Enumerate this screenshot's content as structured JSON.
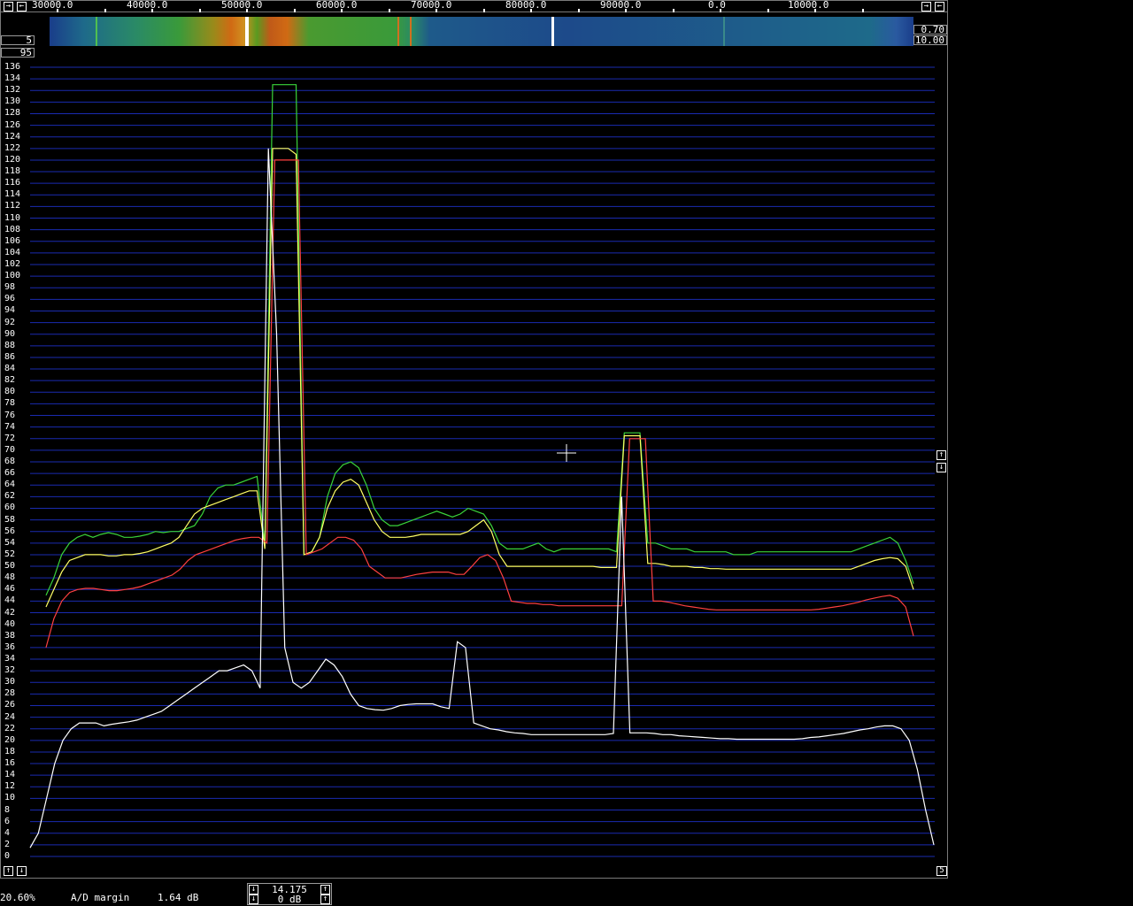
{
  "window": {
    "freq_axis_labels": [
      "30000.0",
      "40000.0",
      "50000.0",
      "60000.0",
      "70000.0",
      "80000.0",
      "90000.0",
      "0.0",
      "10000.0"
    ],
    "left_value_top": "5",
    "left_value_bottom": "95",
    "right_value_top": "0.70",
    "right_value_bottom": "10.00",
    "y_axis_labels": [
      "136",
      "134",
      "132",
      "130",
      "128",
      "126",
      "124",
      "122",
      "120",
      "118",
      "116",
      "114",
      "112",
      "110",
      "108",
      "106",
      "104",
      "102",
      "100",
      "98",
      "96",
      "94",
      "92",
      "90",
      "88",
      "86",
      "84",
      "82",
      "80",
      "78",
      "76",
      "74",
      "72",
      "70",
      "68",
      "66",
      "64",
      "62",
      "60",
      "58",
      "56",
      "54",
      "52",
      "50",
      "48",
      "46",
      "44",
      "42",
      "40",
      "38",
      "36",
      "34",
      "32",
      "30",
      "28",
      "26",
      "24",
      "22",
      "20",
      "18",
      "16",
      "14",
      "12",
      "10",
      "8",
      "6",
      "4",
      "2",
      "0"
    ],
    "bottom_right_value": "5"
  },
  "status": {
    "percent": "20.60%",
    "ad_margin_label": "A/D margin",
    "ad_margin_value": "1.64 dB",
    "freq_value": "14.175",
    "gain_value": "0 dB"
  },
  "colors": {
    "grid": "#1a2bb0",
    "green_trace": "#3ad43a",
    "yellow_trace": "#ffff66",
    "red_trace": "#ff4040",
    "white_trace": "#ffffff"
  },
  "chart_data": {
    "type": "line",
    "ylim": [
      0,
      136
    ],
    "series": [
      {
        "values": [
          45,
          48,
          52,
          54,
          55,
          55.5,
          55,
          55.5,
          55.8,
          55.5,
          55,
          55,
          55.2,
          55.5,
          56,
          55.8,
          56,
          56,
          56.5,
          57,
          59,
          62,
          63.5,
          64,
          64,
          64.5,
          65,
          65.5,
          54,
          133,
          133,
          133,
          133,
          52,
          52.5,
          55,
          62,
          66,
          67.5,
          68,
          67,
          64,
          60,
          58,
          57,
          57,
          57.5,
          58,
          58.5,
          59,
          59.5,
          59,
          58.5,
          59,
          60,
          59.5,
          59,
          57,
          54,
          53,
          53,
          53,
          53.5,
          54,
          53,
          52.5,
          53,
          53,
          53,
          53,
          53,
          53,
          53,
          52.5,
          73,
          73,
          73,
          54,
          54,
          53.5,
          53,
          53,
          53,
          52.5,
          52.5,
          52.5,
          52.5,
          52.5,
          52,
          52,
          52,
          52.5,
          52.5,
          52.5,
          52.5,
          52.5,
          52.5,
          52.5,
          52.5,
          52.5,
          52.5,
          52.5,
          52.5,
          52.5,
          53,
          53.5,
          54,
          54.5,
          55,
          54,
          51,
          47
        ]
      },
      {
        "values": [
          43,
          46,
          49,
          51,
          51.5,
          52,
          52,
          52,
          51.8,
          51.8,
          52,
          52,
          52.2,
          52.5,
          53,
          53.5,
          54,
          55,
          57,
          59,
          60,
          60.5,
          61,
          61.5,
          62,
          62.5,
          63,
          63,
          53,
          122,
          122,
          122,
          121,
          52,
          52.5,
          55,
          60,
          63,
          64.5,
          65,
          64,
          61,
          58,
          56,
          55,
          55,
          55,
          55.2,
          55.5,
          55.5,
          55.5,
          55.5,
          55.5,
          55.5,
          56,
          57,
          58,
          56,
          52,
          50,
          50,
          50,
          50,
          50,
          50,
          50,
          50,
          50,
          50,
          50,
          50,
          49.8,
          49.8,
          49.8,
          72.5,
          72.5,
          72.5,
          50.5,
          50.5,
          50.3,
          50,
          50,
          50,
          49.8,
          49.8,
          49.6,
          49.6,
          49.5,
          49.5,
          49.5,
          49.5,
          49.5,
          49.5,
          49.5,
          49.5,
          49.5,
          49.5,
          49.5,
          49.5,
          49.5,
          49.5,
          49.5,
          49.5,
          49.5,
          50,
          50.5,
          51,
          51.3,
          51.5,
          51.3,
          50,
          46
        ]
      },
      {
        "values": [
          36,
          41,
          44,
          45.5,
          46,
          46.2,
          46.2,
          46,
          45.8,
          45.8,
          46,
          46.2,
          46.5,
          47,
          47.5,
          48,
          48.5,
          49.5,
          51,
          52,
          52.5,
          53,
          53.5,
          54,
          54.5,
          54.8,
          55,
          55,
          54,
          120,
          120,
          120,
          120,
          52,
          52.5,
          53,
          54,
          55,
          55,
          54.5,
          53,
          50,
          49,
          48,
          48,
          48,
          48.3,
          48.6,
          48.8,
          49,
          49,
          49,
          48.6,
          48.6,
          50,
          51.5,
          52,
          51,
          48,
          44,
          43.8,
          43.6,
          43.6,
          43.4,
          43.4,
          43.2,
          43.2,
          43.2,
          43.2,
          43.2,
          43.2,
          43.2,
          43.2,
          43.2,
          72,
          72,
          72,
          44,
          44,
          43.8,
          43.5,
          43.2,
          43,
          42.8,
          42.6,
          42.5,
          42.5,
          42.5,
          42.5,
          42.5,
          42.5,
          42.5,
          42.5,
          42.5,
          42.5,
          42.5,
          42.5,
          42.5,
          42.6,
          42.8,
          43,
          43.2,
          43.5,
          43.8,
          44.2,
          44.5,
          44.8,
          45,
          44.5,
          43,
          38
        ]
      },
      {
        "values": [
          1.5,
          4,
          10,
          16,
          20,
          22,
          23,
          23,
          23,
          22.5,
          22.8,
          23,
          23.2,
          23.5,
          24,
          24.5,
          25,
          26,
          27,
          28,
          29,
          30,
          31,
          32,
          32,
          32.5,
          33,
          32,
          29,
          122,
          90,
          36,
          30,
          29,
          30,
          32,
          34,
          33,
          31,
          28,
          26,
          25.5,
          25.3,
          25.2,
          25.5,
          26,
          26.2,
          26.3,
          26.3,
          26.3,
          25.8,
          25.5,
          37,
          36,
          23,
          22.5,
          22,
          21.8,
          21.5,
          21.3,
          21.2,
          21,
          21,
          21,
          21,
          21,
          21,
          21,
          21,
          21,
          21,
          21.2,
          62,
          21.3,
          21.3,
          21.3,
          21.2,
          21,
          21,
          20.8,
          20.7,
          20.6,
          20.5,
          20.4,
          20.3,
          20.3,
          20.2,
          20.2,
          20.2,
          20.2,
          20.2,
          20.2,
          20.2,
          20.2,
          20.3,
          20.5,
          20.6,
          20.8,
          21,
          21.2,
          21.5,
          21.8,
          22,
          22.3,
          22.5,
          22.5,
          22,
          20,
          15,
          8,
          2
        ]
      }
    ]
  }
}
